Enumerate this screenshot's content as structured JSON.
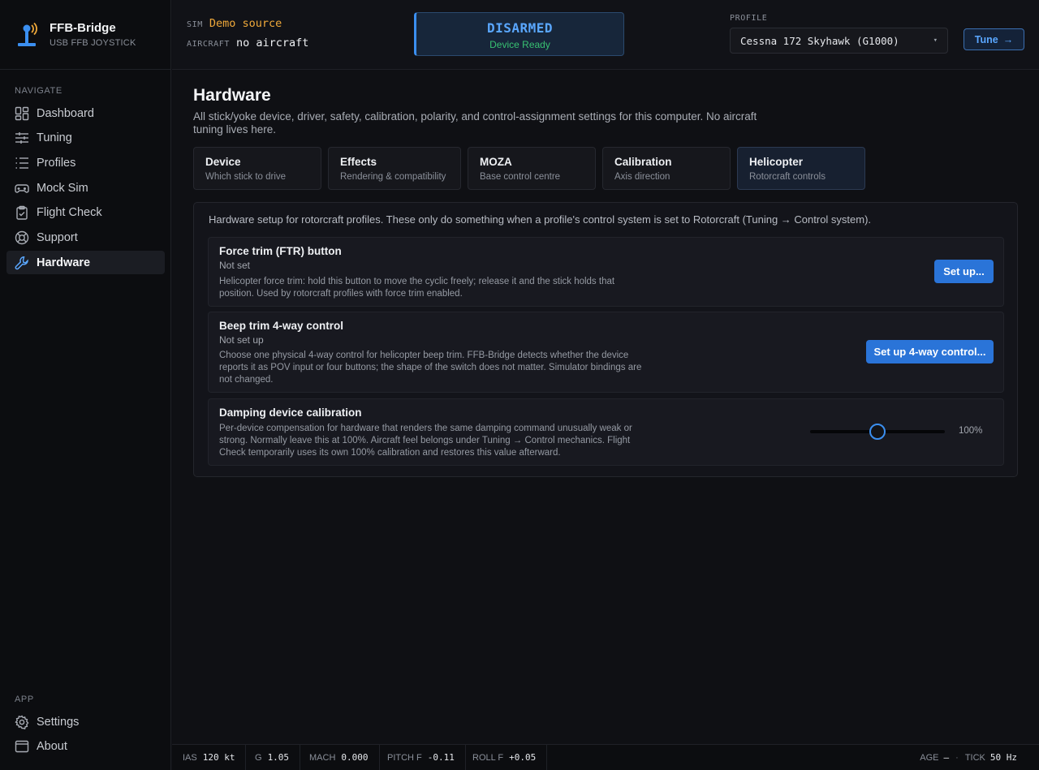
{
  "brand": {
    "name": "FFB-Bridge",
    "subtitle": "USB FFB JOYSTICK"
  },
  "sidebar": {
    "navigate_heading": "NAVIGATE",
    "items": [
      {
        "label": "Dashboard",
        "icon": "dashboard-icon"
      },
      {
        "label": "Tuning",
        "icon": "sliders-icon"
      },
      {
        "label": "Profiles",
        "icon": "list-icon"
      },
      {
        "label": "Mock Sim",
        "icon": "gamepad-icon"
      },
      {
        "label": "Flight Check",
        "icon": "clipboard-check-icon"
      },
      {
        "label": "Support",
        "icon": "lifebuoy-icon"
      },
      {
        "label": "Hardware",
        "icon": "wrench-icon",
        "active": true
      }
    ],
    "app_heading": "APP",
    "app_items": [
      {
        "label": "Settings",
        "icon": "gear-icon"
      },
      {
        "label": "About",
        "icon": "window-icon"
      }
    ]
  },
  "topbar": {
    "sim_label": "SIM",
    "sim_value": "Demo source",
    "aircraft_label": "AIRCRAFT",
    "aircraft_value": "no aircraft",
    "arm_state": "DISARMED",
    "device_state": "Device Ready",
    "profile_label": "PROFILE",
    "profile_value": "Cessna 172 Skyhawk (G1000)",
    "tune_label": "Tune",
    "colors": {
      "sim_value": "#f0a93a",
      "arm_state": "#5aa7ff",
      "device_state": "#38c172"
    }
  },
  "page": {
    "title": "Hardware",
    "description": "All stick/yoke device, driver, safety, calibration, polarity, and control-assignment settings for this computer. No aircraft tuning lives here."
  },
  "tabs": [
    {
      "title": "Device",
      "subtitle": "Which stick to drive"
    },
    {
      "title": "Effects",
      "subtitle": "Rendering & compatibility"
    },
    {
      "title": "MOZA",
      "subtitle": "Base control centre"
    },
    {
      "title": "Calibration",
      "subtitle": "Axis direction"
    },
    {
      "title": "Helicopter",
      "subtitle": "Rotorcraft controls",
      "active": true
    }
  ],
  "panel": {
    "intro": "Hardware setup for rotorcraft profiles. These only do something when a profile's control system is set to Rotorcraft (Tuning → Control system).",
    "force_trim": {
      "title": "Force trim (FTR) button",
      "status": "Not set",
      "description": "Helicopter force trim: hold this button to move the cyclic freely; release it and the stick holds that position. Used by rotorcraft profiles with force trim enabled.",
      "button": "Set up..."
    },
    "beep_trim": {
      "title": "Beep trim 4-way control",
      "status": "Not set up",
      "description": "Choose one physical 4-way control for helicopter beep trim. FFB-Bridge detects whether the device reports it as POV input or four buttons; the shape of the switch does not matter. Simulator bindings are not changed.",
      "button": "Set up 4-way control..."
    },
    "damping": {
      "title": "Damping device calibration",
      "description": "Per-device compensation for hardware that renders the same damping command unusually weak or strong. Normally leave this at 100%. Aircraft feel belongs under Tuning → Control mechanics. Flight Check temporarily uses its own 100% calibration and restores this value afterward.",
      "value_label": "100%",
      "slider_fraction": 0.5
    }
  },
  "statusbar": {
    "ias": {
      "label": "IAS",
      "value": "120 kt"
    },
    "g": {
      "label": "G",
      "value": "1.05"
    },
    "mach": {
      "label": "MACH",
      "value": "0.000"
    },
    "pitch": {
      "label": "PITCH F",
      "value": "-0.11"
    },
    "roll": {
      "label": "ROLL F",
      "value": "+0.05"
    },
    "age": {
      "label": "AGE",
      "value": "—"
    },
    "tick": {
      "label": "TICK",
      "value": "50 Hz"
    }
  }
}
